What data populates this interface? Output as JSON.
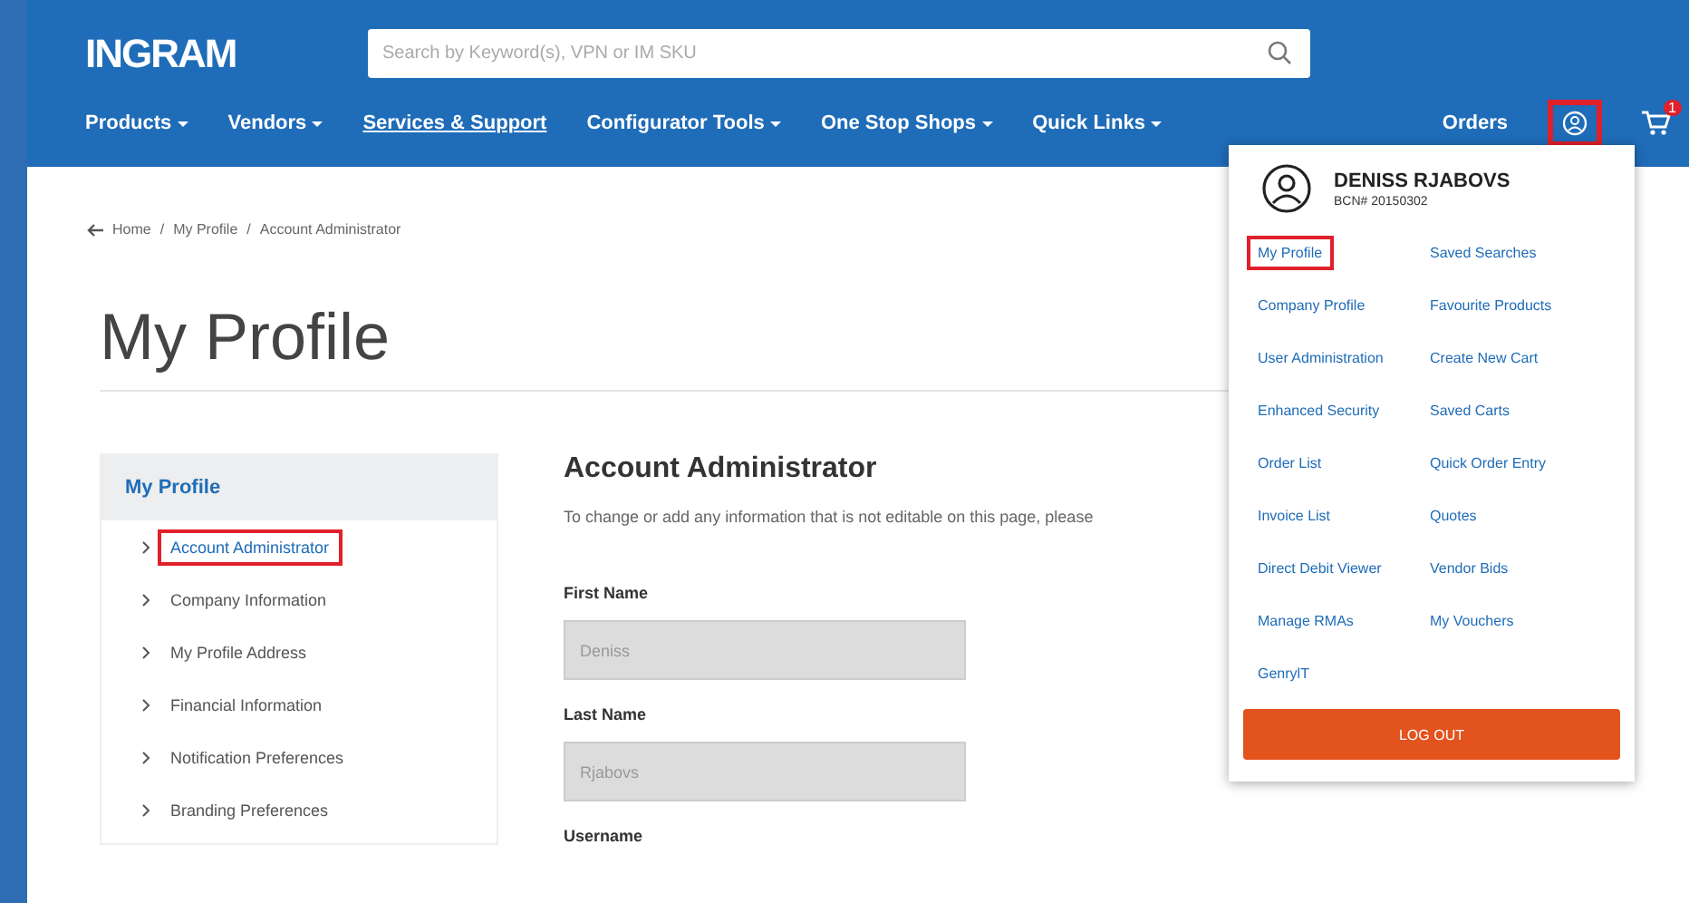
{
  "header": {
    "logo": "INGRAM",
    "search": {
      "placeholder": "Search by Keyword(s), VPN or IM SKU"
    },
    "nav": [
      {
        "label": "Products",
        "dropdown": true
      },
      {
        "label": "Vendors",
        "dropdown": true
      },
      {
        "label": "Services & Support",
        "dropdown": false
      },
      {
        "label": "Configurator Tools",
        "dropdown": true
      },
      {
        "label": "One Stop Shops",
        "dropdown": true
      },
      {
        "label": "Quick Links",
        "dropdown": true
      }
    ],
    "orders": "Orders",
    "account_highlighted": true,
    "cart_badge": "1"
  },
  "breadcrumb": {
    "separator": "/",
    "items": [
      "Home",
      "My Profile",
      "Account Administrator"
    ]
  },
  "page_title": "My Profile",
  "sidebar": {
    "title": "My Profile",
    "items": [
      {
        "label": "Account Administrator",
        "selected": true,
        "highlighted": true
      },
      {
        "label": "Company Information",
        "selected": false,
        "highlighted": false
      },
      {
        "label": "My Profile Address",
        "selected": false,
        "highlighted": false
      },
      {
        "label": "Financial Information",
        "selected": false,
        "highlighted": false
      },
      {
        "label": "Notification Preferences",
        "selected": false,
        "highlighted": false
      },
      {
        "label": "Branding Preferences",
        "selected": false,
        "highlighted": false
      }
    ]
  },
  "content": {
    "title": "Account Administrator",
    "note": "To change or add any information that is not editable on this page, please",
    "fields": [
      {
        "label": "First Name",
        "value": "Deniss",
        "disabled": true
      },
      {
        "label": "Last Name",
        "value": "Rjabovs",
        "disabled": true
      },
      {
        "label": "Username"
      }
    ]
  },
  "account_menu": {
    "name": "DENISS RJABOVS",
    "bcn": "BCN# 20150302",
    "links": [
      {
        "label": "My Profile",
        "highlighted": true
      },
      {
        "label": "Saved Searches",
        "highlighted": false
      },
      {
        "label": "Company Profile",
        "highlighted": false
      },
      {
        "label": "Favourite Products",
        "highlighted": false
      },
      {
        "label": "User Administration",
        "highlighted": false
      },
      {
        "label": "Create New Cart",
        "highlighted": false
      },
      {
        "label": "Enhanced Security",
        "highlighted": false
      },
      {
        "label": "Saved Carts",
        "highlighted": false
      },
      {
        "label": "Order List",
        "highlighted": false
      },
      {
        "label": "Quick Order Entry",
        "highlighted": false
      },
      {
        "label": "Invoice List",
        "highlighted": false
      },
      {
        "label": "Quotes",
        "highlighted": false
      },
      {
        "label": "Direct Debit Viewer",
        "highlighted": false
      },
      {
        "label": "Vendor Bids",
        "highlighted": false
      },
      {
        "label": "Manage RMAs",
        "highlighted": false
      },
      {
        "label": "My Vouchers",
        "highlighted": false
      },
      {
        "label": "GenrylT",
        "highlighted": false
      }
    ],
    "logout": "LOG OUT"
  }
}
